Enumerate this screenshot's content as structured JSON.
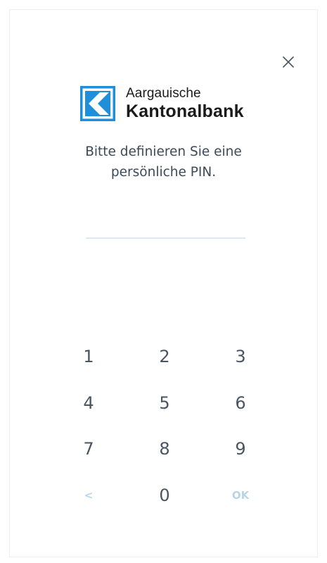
{
  "colors": {
    "brand_blue": "#1e8fd8",
    "text_dark": "#3d4a57",
    "key_text": "#4a5560",
    "disabled": "#b9d4e8",
    "field_line": "#dce9f4"
  },
  "header": {
    "close_icon": "close-icon"
  },
  "logo": {
    "line1": "Aargauische",
    "line2": "Kantonalbank"
  },
  "prompt": {
    "line1": "Bitte definieren Sie eine",
    "line2": "persönliche PIN."
  },
  "pin": {
    "value": ""
  },
  "keypad": {
    "k1": "1",
    "k2": "2",
    "k3": "3",
    "k4": "4",
    "k5": "5",
    "k6": "6",
    "k7": "7",
    "k8": "8",
    "k9": "9",
    "back": "<",
    "k0": "0",
    "ok": "OK"
  }
}
